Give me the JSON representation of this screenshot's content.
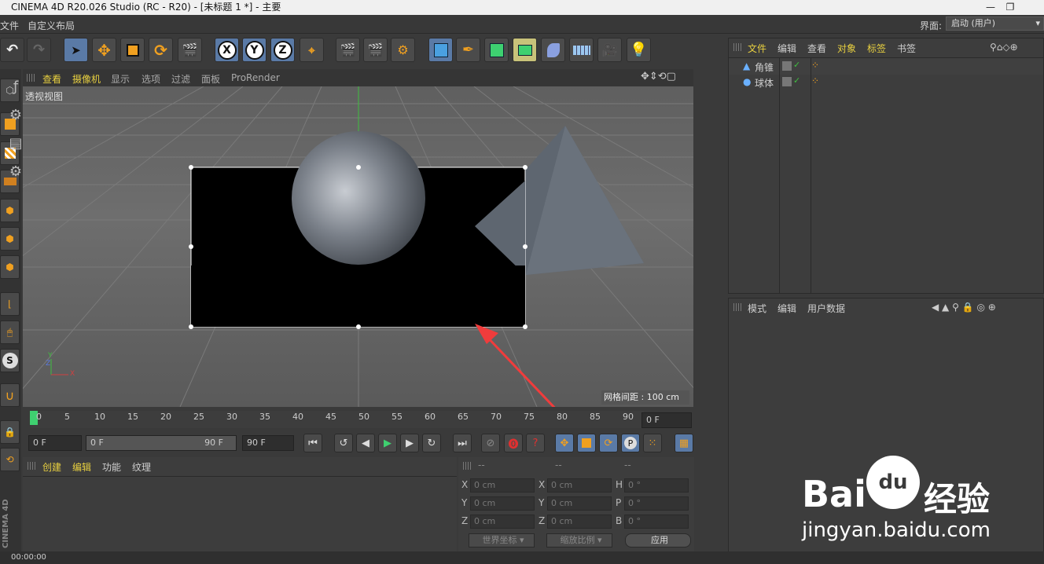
{
  "window": {
    "title": "CINEMA 4D R20.026 Studio (RC - R20) - [未标题 1 *] - 主要",
    "controls": [
      "—",
      "❐"
    ]
  },
  "menubar": {
    "items": [
      "文件",
      "自定义布局"
    ],
    "layout_label": "界面:",
    "layout_value": "启动 (用户)"
  },
  "viewport": {
    "menu": [
      "查看",
      "摄像机",
      "显示",
      "选项",
      "过滤",
      "面板",
      "ProRender"
    ],
    "camera_label": "透视视图",
    "grid_spacing": "网格间距 : 100 cm",
    "axis": {
      "y": "Y",
      "z": "Z",
      "x": "X"
    }
  },
  "object_manager": {
    "menu": [
      "文件",
      "编辑",
      "查看",
      "对象",
      "标签",
      "书签"
    ],
    "objects": [
      {
        "name": "角锥"
      },
      {
        "name": "球体"
      }
    ]
  },
  "attribute_manager": {
    "menu": [
      "模式",
      "编辑",
      "用户数据"
    ]
  },
  "timeline": {
    "ticks": [
      "0",
      "5",
      "10",
      "15",
      "20",
      "25",
      "30",
      "35",
      "40",
      "45",
      "50",
      "55",
      "60",
      "65",
      "70",
      "75",
      "80",
      "85",
      "90"
    ],
    "current_frame": "0 F"
  },
  "transport": {
    "start": "0 F",
    "range_start": "0 F",
    "range_end": "90 F",
    "end": "90 F"
  },
  "material_manager": {
    "menu": [
      "创建",
      "编辑",
      "功能",
      "纹理"
    ]
  },
  "coordinates": {
    "headers": [
      "--",
      "--",
      "--"
    ],
    "rows": [
      {
        "l1": "X",
        "v1": "0 cm",
        "l2": "X",
        "v2": "0 cm",
        "l3": "H",
        "v3": "0 °"
      },
      {
        "l1": "Y",
        "v1": "0 cm",
        "l2": "Y",
        "v2": "0 cm",
        "l3": "P",
        "v3": "0 °"
      },
      {
        "l1": "Z",
        "v1": "0 cm",
        "l2": "Z",
        "v2": "0 cm",
        "l3": "B",
        "v3": "0 °"
      }
    ],
    "world_coord": "世界坐标",
    "scale": "缩放比例",
    "apply": "应用"
  },
  "status": {
    "time": "00:00:00"
  },
  "left_brand": "CINEMA 4D",
  "watermark": {
    "brand": "Bai",
    "brand_cn": "经验",
    "url": "jingyan.baidu.com"
  },
  "colors": {
    "accent_yellow": "#e8d040",
    "active_blue": "#5a7aa6",
    "arrow_red": "#f03c3c"
  }
}
